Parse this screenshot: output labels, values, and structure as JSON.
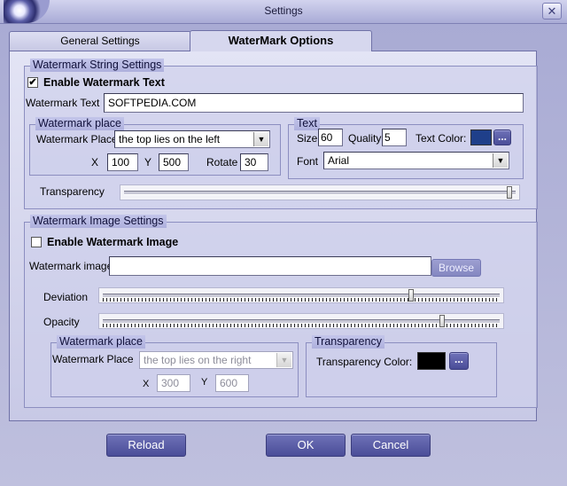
{
  "window": {
    "title": "Settings",
    "close_label": "✕"
  },
  "tabs": [
    {
      "label": "General Settings",
      "active": false
    },
    {
      "label": "WaterMark Options",
      "active": true
    }
  ],
  "string_settings": {
    "group_title": "Watermark String Settings",
    "enable_label": "Enable Watermark Text",
    "enabled": true,
    "text_label": "Watermark Text",
    "text_value": "SOFTPEDIA.COM",
    "place": {
      "group_title": "Watermark place",
      "place_label": "Watermark Place",
      "place_value": "the top lies on the left",
      "x_label": "X",
      "x_value": "100",
      "y_label": "Y",
      "y_value": "500",
      "rotate_label": "Rotate",
      "rotate_value": "30"
    },
    "text": {
      "group_title": "Text",
      "size_label": "Size",
      "size_value": "60",
      "quality_label": "Quality",
      "quality_value": "5",
      "color_label": "Text Color:",
      "color": "#1f3f8a",
      "font_label": "Font",
      "font_value": "Arial",
      "dots_label": "..."
    },
    "transparency_label": "Transparency",
    "transparency_level": 0.99
  },
  "image_settings": {
    "group_title": "Watermark Image Settings",
    "enable_label": "Enable Watermark Image",
    "enabled": false,
    "image_label": "Watermark image",
    "image_value": "",
    "browse_label": "Browse",
    "deviation_label": "Deviation",
    "deviation_level": 0.78,
    "opacity_label": "Opacity",
    "opacity_level": 0.86,
    "place": {
      "group_title": "Watermark place",
      "place_label": "Watermark Place",
      "place_value": "the top lies on the right",
      "x_label": "X",
      "x_value": "300",
      "y_label": "Y",
      "y_value": "600"
    },
    "transparency": {
      "group_title": "Transparency",
      "color_label": "Transparency Color:",
      "color": "#000000",
      "dots_label": "..."
    }
  },
  "buttons": {
    "reload": "Reload",
    "ok": "OK",
    "cancel": "Cancel"
  }
}
